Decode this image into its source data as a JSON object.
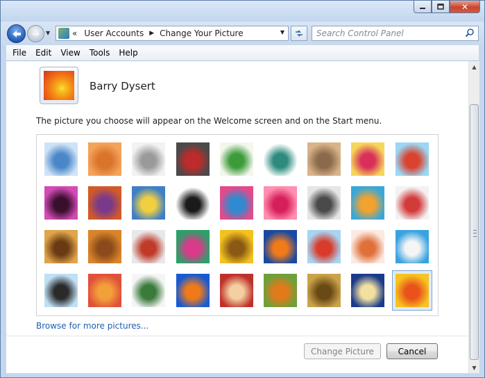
{
  "breadcrumb": {
    "prefix": "«",
    "items": [
      "User Accounts",
      "Change Your Picture"
    ]
  },
  "search": {
    "placeholder": "Search Control Panel"
  },
  "menu": {
    "file": "File",
    "edit": "Edit",
    "view": "View",
    "tools": "Tools",
    "help": "Help"
  },
  "user": {
    "name": "Barry Dysert",
    "picture_icon": "orange-gerbera-flower"
  },
  "description": "The picture you choose will appear on the Welcome screen and on the Start menu.",
  "pictures": [
    {
      "icon": "roller-coaster",
      "colors": [
        "#cfe3f7",
        "#4a86c8"
      ]
    },
    {
      "icon": "starfish",
      "colors": [
        "#f4a35b",
        "#d9742a"
      ]
    },
    {
      "icon": "robot-dog",
      "colors": [
        "#f2f2f2",
        "#9a9a9a"
      ]
    },
    {
      "icon": "turntable",
      "colors": [
        "#4a4a4a",
        "#bf2a2a"
      ]
    },
    {
      "icon": "lucky-cat",
      "colors": [
        "#f3f7ec",
        "#3e9b3a"
      ]
    },
    {
      "icon": "gyroscope",
      "colors": [
        "#ffffff",
        "#2d8a7c"
      ]
    },
    {
      "icon": "kitten",
      "colors": [
        "#d9b38a",
        "#8a6a4a"
      ]
    },
    {
      "icon": "pink-flower",
      "colors": [
        "#f5d65a",
        "#d9305a"
      ]
    },
    {
      "icon": "ferris-wheel",
      "colors": [
        "#9bd6f2",
        "#d9432f"
      ]
    },
    {
      "icon": "purple-ball",
      "colors": [
        "#d24bb6",
        "#3a0f2e"
      ]
    },
    {
      "icon": "fabric",
      "colors": [
        "#d25a2a",
        "#7a3a8a"
      ]
    },
    {
      "icon": "yellow-leaf",
      "colors": [
        "#3f7fc6",
        "#f0d040"
      ]
    },
    {
      "icon": "border-collie",
      "colors": [
        "#ffffff",
        "#1a1a1a"
      ]
    },
    {
      "icon": "crayons",
      "colors": [
        "#e34a8a",
        "#2f8ad0"
      ]
    },
    {
      "icon": "pink-star-lantern",
      "colors": [
        "#ff8fb0",
        "#d61f5a"
      ]
    },
    {
      "icon": "jacks",
      "colors": [
        "#e6e6e6",
        "#4a4a4a"
      ]
    },
    {
      "icon": "stairs",
      "colors": [
        "#3aa7d8",
        "#f2a22e"
      ]
    },
    {
      "icon": "paper-crane",
      "colors": [
        "#f2f2f2",
        "#d33a3a"
      ]
    },
    {
      "icon": "guitar",
      "colors": [
        "#e0a44a",
        "#6a3a14"
      ]
    },
    {
      "icon": "pomeranian",
      "colors": [
        "#d9842a",
        "#8a4a1a"
      ]
    },
    {
      "icon": "toy-robot",
      "colors": [
        "#e8e8e8",
        "#c03a2a"
      ]
    },
    {
      "icon": "scarves",
      "colors": [
        "#2f9e6a",
        "#d93a8a"
      ]
    },
    {
      "icon": "sunflower",
      "colors": [
        "#f2c21f",
        "#8a5a14"
      ]
    },
    {
      "icon": "fish",
      "colors": [
        "#1a4aa0",
        "#f27a1a"
      ]
    },
    {
      "icon": "hot-air-balloon",
      "colors": [
        "#a8d4f2",
        "#d93a2a"
      ]
    },
    {
      "icon": "matryoshka",
      "colors": [
        "#fbeae2",
        "#e0703a"
      ]
    },
    {
      "icon": "sailboat",
      "colors": [
        "#3aa2e0",
        "#f5f5f5"
      ]
    },
    {
      "icon": "soccer-ball",
      "colors": [
        "#bfe0f5",
        "#2a2a2a"
      ]
    },
    {
      "icon": "striped-fabric",
      "colors": [
        "#e0503a",
        "#f2a03a"
      ]
    },
    {
      "icon": "marbles",
      "colors": [
        "#f5f5f5",
        "#3a7a3a"
      ]
    },
    {
      "icon": "window",
      "colors": [
        "#1a5ad0",
        "#f07a1a"
      ]
    },
    {
      "icon": "woven-pattern",
      "colors": [
        "#c0302a",
        "#f2d0a0"
      ]
    },
    {
      "icon": "butterfly",
      "colors": [
        "#6ea03a",
        "#e07a1a"
      ]
    },
    {
      "icon": "golden-spiral",
      "colors": [
        "#caa24a",
        "#6a4a14"
      ]
    },
    {
      "icon": "lighthouse",
      "colors": [
        "#1a3a8a",
        "#f2e0a0"
      ]
    },
    {
      "icon": "orange-gerbera",
      "colors": [
        "#f7c31f",
        "#e9531b"
      ]
    }
  ],
  "selected_index": 35,
  "browse_link": "Browse for more pictures...",
  "buttons": {
    "change": "Change Picture",
    "cancel": "Cancel"
  },
  "caption": {
    "close": "✕"
  }
}
